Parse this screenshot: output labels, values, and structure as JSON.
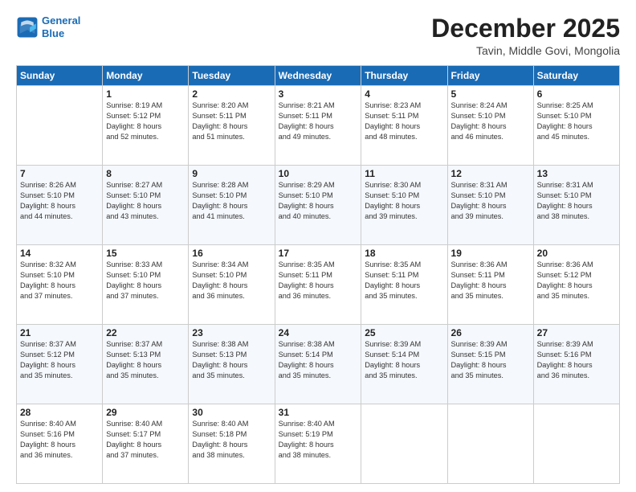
{
  "header": {
    "logo_line1": "General",
    "logo_line2": "Blue",
    "title": "December 2025",
    "subtitle": "Tavin, Middle Govi, Mongolia"
  },
  "calendar": {
    "days_of_week": [
      "Sunday",
      "Monday",
      "Tuesday",
      "Wednesday",
      "Thursday",
      "Friday",
      "Saturday"
    ],
    "weeks": [
      [
        {
          "day": "",
          "info": ""
        },
        {
          "day": "1",
          "info": "Sunrise: 8:19 AM\nSunset: 5:12 PM\nDaylight: 8 hours\nand 52 minutes."
        },
        {
          "day": "2",
          "info": "Sunrise: 8:20 AM\nSunset: 5:11 PM\nDaylight: 8 hours\nand 51 minutes."
        },
        {
          "day": "3",
          "info": "Sunrise: 8:21 AM\nSunset: 5:11 PM\nDaylight: 8 hours\nand 49 minutes."
        },
        {
          "day": "4",
          "info": "Sunrise: 8:23 AM\nSunset: 5:11 PM\nDaylight: 8 hours\nand 48 minutes."
        },
        {
          "day": "5",
          "info": "Sunrise: 8:24 AM\nSunset: 5:10 PM\nDaylight: 8 hours\nand 46 minutes."
        },
        {
          "day": "6",
          "info": "Sunrise: 8:25 AM\nSunset: 5:10 PM\nDaylight: 8 hours\nand 45 minutes."
        }
      ],
      [
        {
          "day": "7",
          "info": "Sunrise: 8:26 AM\nSunset: 5:10 PM\nDaylight: 8 hours\nand 44 minutes."
        },
        {
          "day": "8",
          "info": "Sunrise: 8:27 AM\nSunset: 5:10 PM\nDaylight: 8 hours\nand 43 minutes."
        },
        {
          "day": "9",
          "info": "Sunrise: 8:28 AM\nSunset: 5:10 PM\nDaylight: 8 hours\nand 41 minutes."
        },
        {
          "day": "10",
          "info": "Sunrise: 8:29 AM\nSunset: 5:10 PM\nDaylight: 8 hours\nand 40 minutes."
        },
        {
          "day": "11",
          "info": "Sunrise: 8:30 AM\nSunset: 5:10 PM\nDaylight: 8 hours\nand 39 minutes."
        },
        {
          "day": "12",
          "info": "Sunrise: 8:31 AM\nSunset: 5:10 PM\nDaylight: 8 hours\nand 39 minutes."
        },
        {
          "day": "13",
          "info": "Sunrise: 8:31 AM\nSunset: 5:10 PM\nDaylight: 8 hours\nand 38 minutes."
        }
      ],
      [
        {
          "day": "14",
          "info": "Sunrise: 8:32 AM\nSunset: 5:10 PM\nDaylight: 8 hours\nand 37 minutes."
        },
        {
          "day": "15",
          "info": "Sunrise: 8:33 AM\nSunset: 5:10 PM\nDaylight: 8 hours\nand 37 minutes."
        },
        {
          "day": "16",
          "info": "Sunrise: 8:34 AM\nSunset: 5:10 PM\nDaylight: 8 hours\nand 36 minutes."
        },
        {
          "day": "17",
          "info": "Sunrise: 8:35 AM\nSunset: 5:11 PM\nDaylight: 8 hours\nand 36 minutes."
        },
        {
          "day": "18",
          "info": "Sunrise: 8:35 AM\nSunset: 5:11 PM\nDaylight: 8 hours\nand 35 minutes."
        },
        {
          "day": "19",
          "info": "Sunrise: 8:36 AM\nSunset: 5:11 PM\nDaylight: 8 hours\nand 35 minutes."
        },
        {
          "day": "20",
          "info": "Sunrise: 8:36 AM\nSunset: 5:12 PM\nDaylight: 8 hours\nand 35 minutes."
        }
      ],
      [
        {
          "day": "21",
          "info": "Sunrise: 8:37 AM\nSunset: 5:12 PM\nDaylight: 8 hours\nand 35 minutes."
        },
        {
          "day": "22",
          "info": "Sunrise: 8:37 AM\nSunset: 5:13 PM\nDaylight: 8 hours\nand 35 minutes."
        },
        {
          "day": "23",
          "info": "Sunrise: 8:38 AM\nSunset: 5:13 PM\nDaylight: 8 hours\nand 35 minutes."
        },
        {
          "day": "24",
          "info": "Sunrise: 8:38 AM\nSunset: 5:14 PM\nDaylight: 8 hours\nand 35 minutes."
        },
        {
          "day": "25",
          "info": "Sunrise: 8:39 AM\nSunset: 5:14 PM\nDaylight: 8 hours\nand 35 minutes."
        },
        {
          "day": "26",
          "info": "Sunrise: 8:39 AM\nSunset: 5:15 PM\nDaylight: 8 hours\nand 35 minutes."
        },
        {
          "day": "27",
          "info": "Sunrise: 8:39 AM\nSunset: 5:16 PM\nDaylight: 8 hours\nand 36 minutes."
        }
      ],
      [
        {
          "day": "28",
          "info": "Sunrise: 8:40 AM\nSunset: 5:16 PM\nDaylight: 8 hours\nand 36 minutes."
        },
        {
          "day": "29",
          "info": "Sunrise: 8:40 AM\nSunset: 5:17 PM\nDaylight: 8 hours\nand 37 minutes."
        },
        {
          "day": "30",
          "info": "Sunrise: 8:40 AM\nSunset: 5:18 PM\nDaylight: 8 hours\nand 38 minutes."
        },
        {
          "day": "31",
          "info": "Sunrise: 8:40 AM\nSunset: 5:19 PM\nDaylight: 8 hours\nand 38 minutes."
        },
        {
          "day": "",
          "info": ""
        },
        {
          "day": "",
          "info": ""
        },
        {
          "day": "",
          "info": ""
        }
      ]
    ]
  }
}
